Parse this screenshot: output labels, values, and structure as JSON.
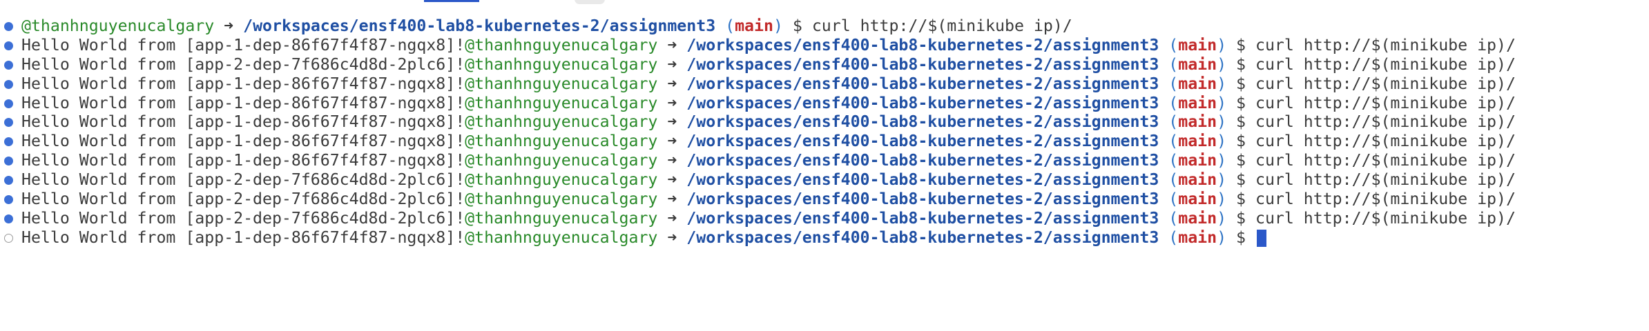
{
  "terminal": {
    "prompt": {
      "user": "@thanhnguyenucalgary",
      "arrow": "➜",
      "path": "/workspaces/ensf400-lab8-kubernetes-2/assignment3",
      "paren_open": "(",
      "branch": "main",
      "paren_close": ")",
      "symbol": "$"
    },
    "lines": [
      {
        "output": "",
        "command": "curl http://$(minikube ip)/",
        "status": "done"
      },
      {
        "output": "Hello World from [app-1-dep-86f67f4f87-ngqx8]!",
        "command": "curl http://$(minikube ip)/",
        "status": "done"
      },
      {
        "output": "Hello World from [app-2-dep-7f686c4d8d-2plc6]!",
        "command": "curl http://$(minikube ip)/",
        "status": "done"
      },
      {
        "output": "Hello World from [app-1-dep-86f67f4f87-ngqx8]!",
        "command": "curl http://$(minikube ip)/",
        "status": "done"
      },
      {
        "output": "Hello World from [app-1-dep-86f67f4f87-ngqx8]!",
        "command": "curl http://$(minikube ip)/",
        "status": "done"
      },
      {
        "output": "Hello World from [app-1-dep-86f67f4f87-ngqx8]!",
        "command": "curl http://$(minikube ip)/",
        "status": "done"
      },
      {
        "output": "Hello World from [app-1-dep-86f67f4f87-ngqx8]!",
        "command": "curl http://$(minikube ip)/",
        "status": "done"
      },
      {
        "output": "Hello World from [app-1-dep-86f67f4f87-ngqx8]!",
        "command": "curl http://$(minikube ip)/",
        "status": "done"
      },
      {
        "output": "Hello World from [app-2-dep-7f686c4d8d-2plc6]!",
        "command": "curl http://$(minikube ip)/",
        "status": "done"
      },
      {
        "output": "Hello World from [app-2-dep-7f686c4d8d-2plc6]!",
        "command": "curl http://$(minikube ip)/",
        "status": "done"
      },
      {
        "output": "Hello World from [app-2-dep-7f686c4d8d-2plc6]!",
        "command": "curl http://$(minikube ip)/",
        "status": "done"
      },
      {
        "output": "Hello World from [app-1-dep-86f67f4f87-ngqx8]!",
        "command": "",
        "status": "pending"
      }
    ]
  },
  "colors": {
    "user": "#2a8a2a",
    "path": "#1f4fa3",
    "branch": "#c22a2a",
    "decoration_done": "#3c6fd6",
    "cursor": "#2b58c9"
  },
  "icons": {
    "decoration_done": "filled-circle",
    "decoration_pending": "hollow-circle"
  }
}
